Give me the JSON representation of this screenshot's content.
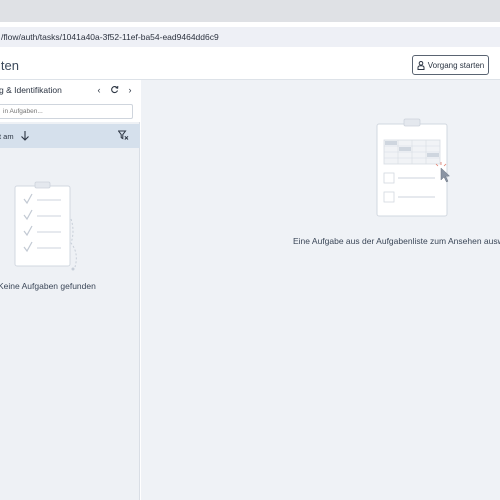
{
  "browser": {
    "url": "/flow/auth/tasks/1041a40a-3f52-11ef-ba54-ead9464dd6c9"
  },
  "header": {
    "title": "iten",
    "start_button_label": "Vorgang starten",
    "start_button_icon": "person-icon"
  },
  "task_list": {
    "title": "g & Identifikation",
    "nav": {
      "prev_icon": "chevron-left-icon",
      "refresh_icon": "refresh-icon",
      "next_icon": "chevron-right-icon"
    },
    "search_placeholder": "in Aufgaben...",
    "sort_label": "t am",
    "sort_icon": "arrow-down-icon",
    "filter_icon": "filter-clear-icon",
    "empty_message": "Keine Aufgaben gefunden"
  },
  "detail": {
    "empty_message": "Eine Aufgabe aus der Aufgabenliste zum Ansehen ausw"
  },
  "colors": {
    "panel_bg": "#eef1f5",
    "sort_row_bg": "#d5e0ec",
    "text": "#3b4758"
  }
}
